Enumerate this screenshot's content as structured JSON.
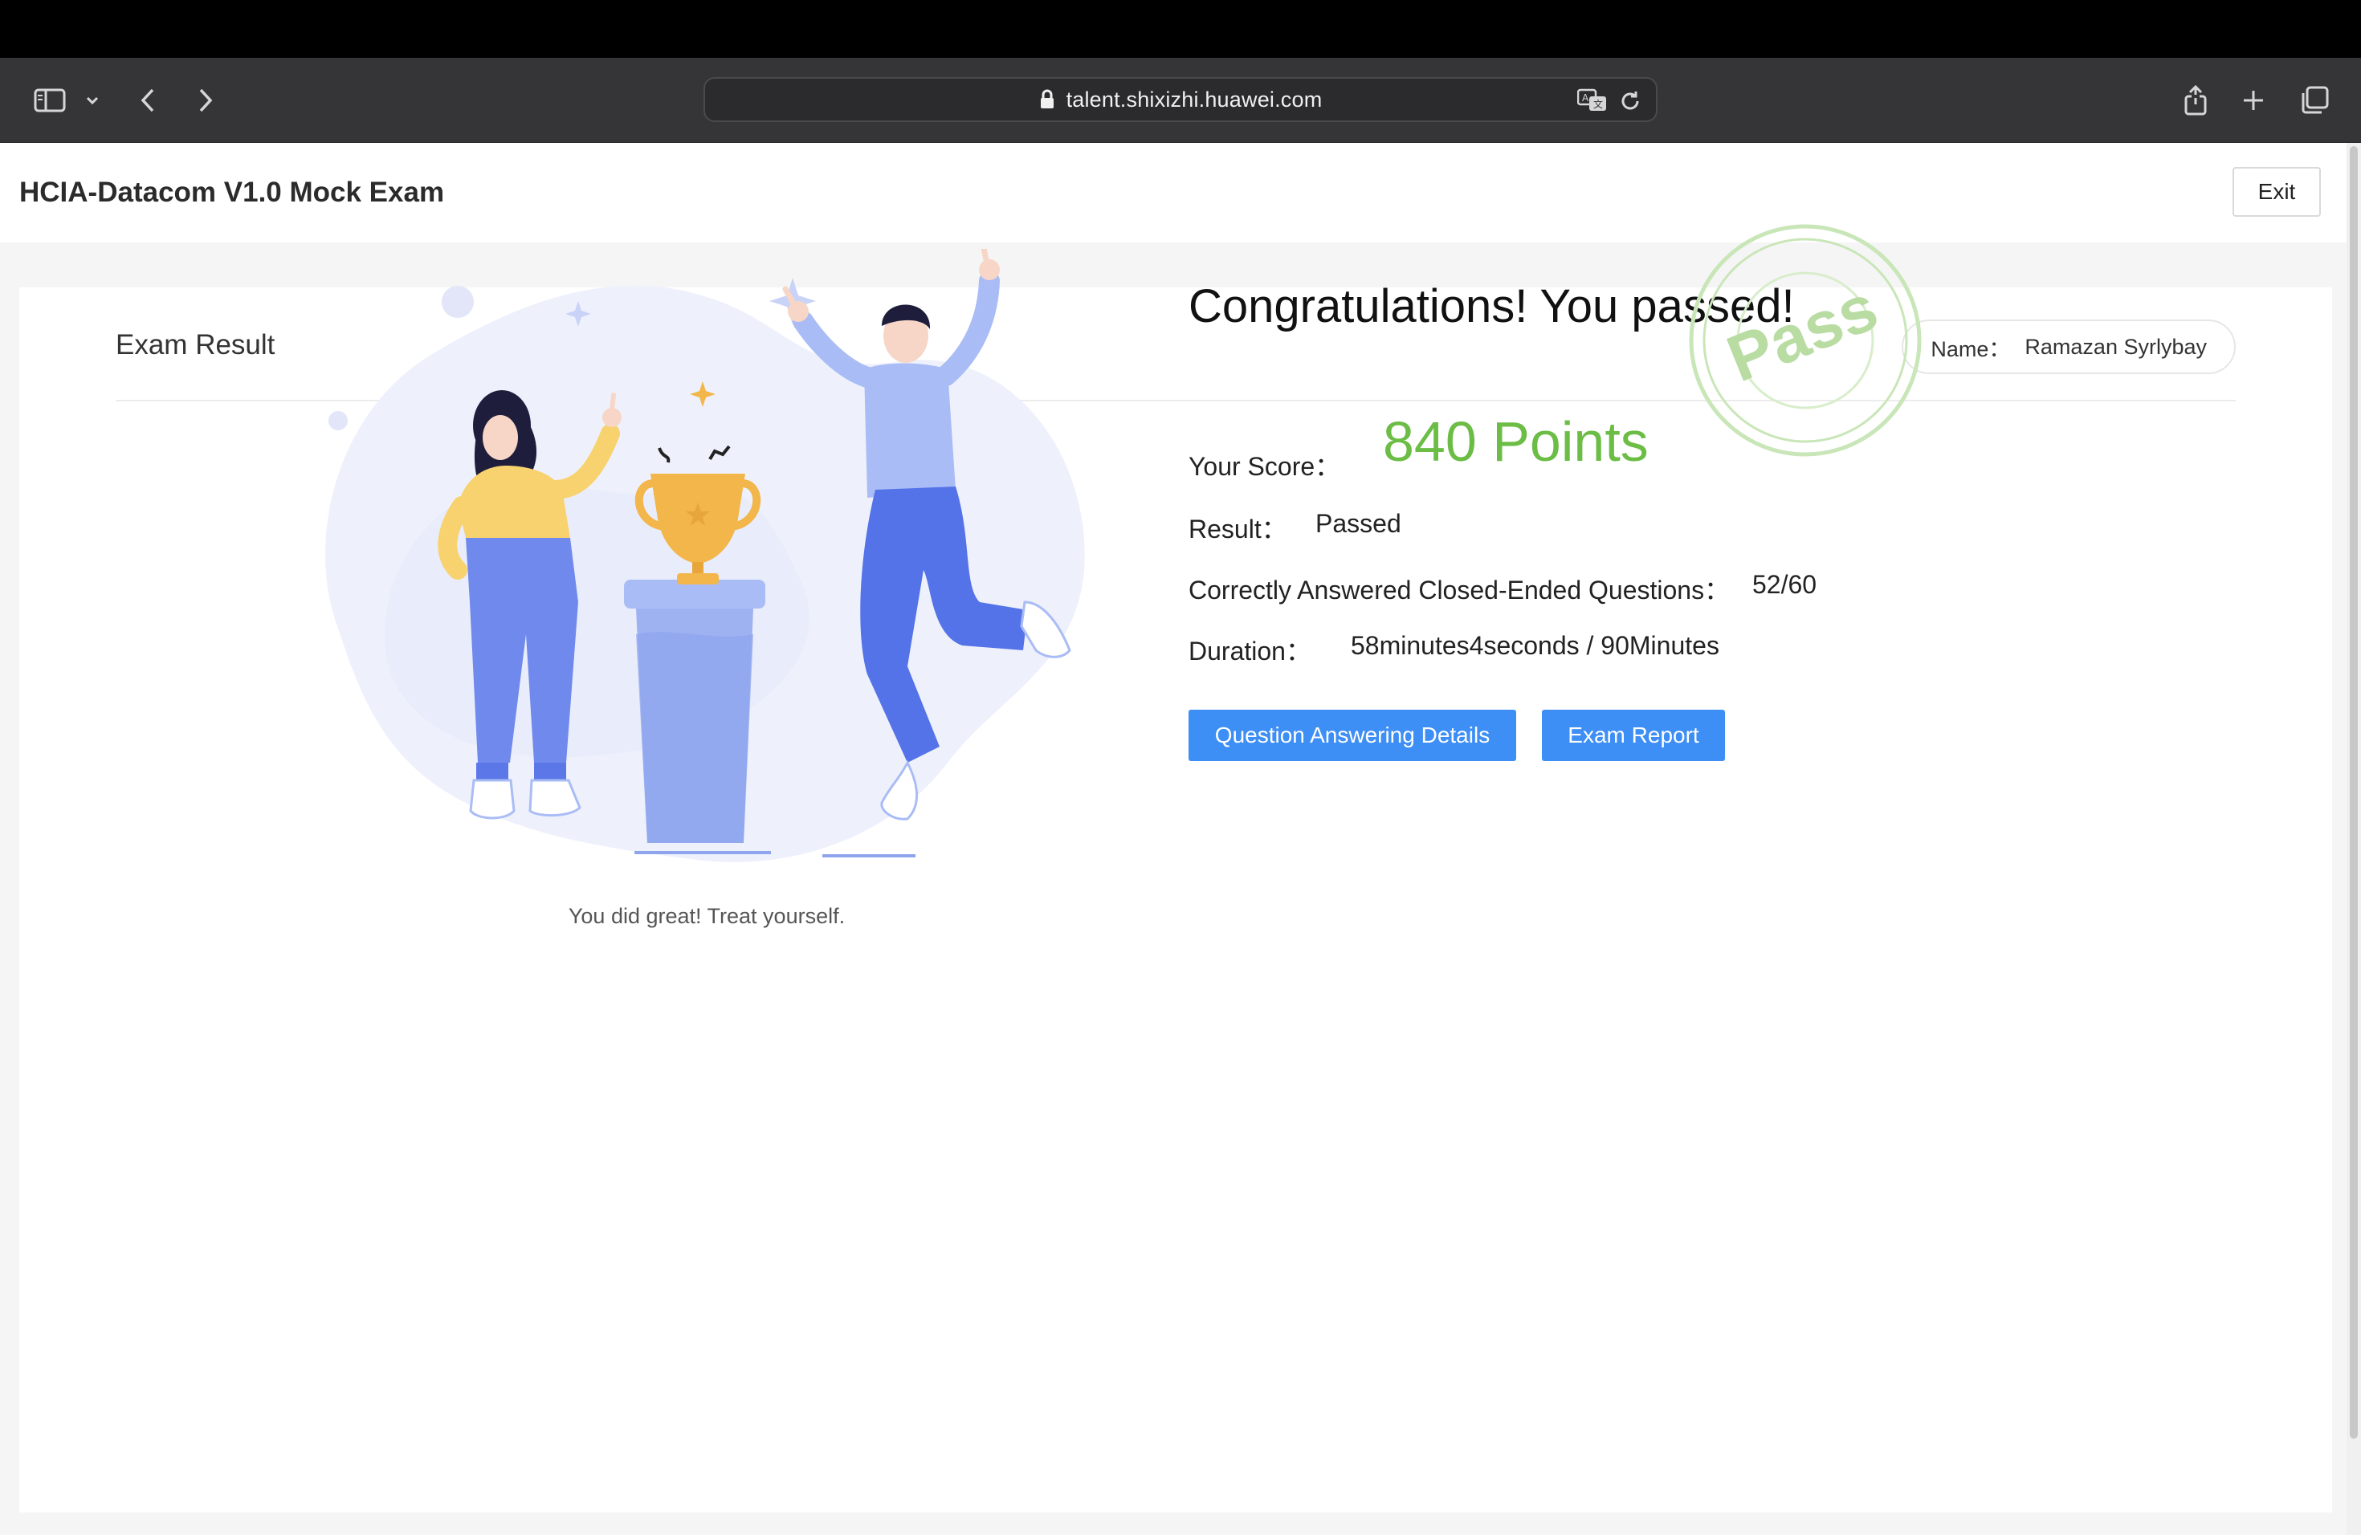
{
  "browser": {
    "url": "talent.shixizhi.huawei.com",
    "icons": [
      "sidebar-icon",
      "chevron-down-icon",
      "back-icon",
      "forward-icon",
      "lock-icon",
      "translate-icon",
      "reload-icon",
      "share-icon",
      "new-tab-icon",
      "tabs-overview-icon"
    ]
  },
  "header": {
    "title": "HCIA-Datacom V1.0 Mock Exam",
    "exit_label": "Exit"
  },
  "card": {
    "title": "Exam Result",
    "name_label": "Name：",
    "name_value": "Ramazan Syrlybay"
  },
  "illustration": {
    "caption": "You did great! Treat yourself."
  },
  "result": {
    "headline": "Congratulations! You passed!",
    "stamp_text": "Pass",
    "score_label": "Your Score：",
    "score_value": "840 Points",
    "result_label": "Result：",
    "result_value": "Passed",
    "correct_label": "Correctly Answered Closed-Ended Questions：",
    "correct_value": "52/60",
    "duration_label": "Duration：",
    "duration_value": "58minutes4seconds / 90Minutes"
  },
  "actions": {
    "details_label": "Question Answering Details",
    "report_label": "Exam Report"
  },
  "colors": {
    "accent_blue": "#3d8ef5",
    "score_green": "#6cbd45",
    "stamp_green": "#c9e6b8"
  }
}
